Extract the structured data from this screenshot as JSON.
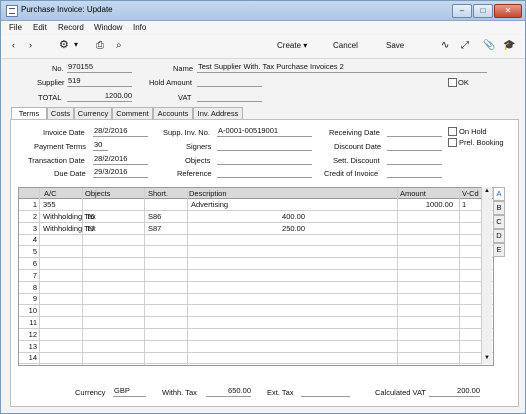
{
  "window": {
    "title": "Purchase Invoice: Update"
  },
  "menu": [
    "File",
    "Edit",
    "Record",
    "Window",
    "Info"
  ],
  "toolbar": {
    "create_label": "Create",
    "cancel_label": "Cancel",
    "save_label": "Save"
  },
  "header": {
    "no_label": "No.",
    "no_value": "970155",
    "name_label": "Name",
    "name_value": "Test Supplier With. Tax Purchase Invoices 2",
    "supplier_label": "Supplier",
    "supplier_value": "519",
    "hold_amount_label": "Hold Amount",
    "hold_amount_value": "",
    "ok_label": "OK",
    "total_label": "TOTAL",
    "total_value": "1200.00",
    "vat_label": "VAT",
    "vat_value": ""
  },
  "tabs": [
    "Terms",
    "Costs",
    "Currency",
    "Comment",
    "Accounts",
    "Inv. Address"
  ],
  "terms": {
    "invoice_date_label": "Invoice Date",
    "invoice_date": "28/2/2016",
    "supp_inv_no_label": "Supp. Inv. No.",
    "supp_inv_no": "A-0001-00519001",
    "receiving_date_label": "Receiving Date",
    "receiving_date": "",
    "on_hold_label": "On Hold",
    "payment_terms_label": "Payment Terms",
    "payment_terms": "30",
    "signers_label": "Signers",
    "signers": "",
    "discount_date_label": "Discount Date",
    "discount_date": "",
    "prel_booking_label": "Prel. Booking",
    "transaction_date_label": "Transaction Date",
    "transaction_date": "28/2/2016",
    "objects_label": "Objects",
    "objects": "",
    "sett_discount_label": "Sett. Discount",
    "sett_discount": "",
    "due_date_label": "Due Date",
    "due_date": "29/3/2016",
    "reference_label": "Reference",
    "reference": "",
    "credit_of_invoice_label": "Credit of Invoice",
    "credit_of_invoice": ""
  },
  "grid": {
    "columns": [
      "A/C",
      "Objects",
      "Short.",
      "Description",
      "Amount",
      "V-Cd"
    ],
    "rows": [
      {
        "n": "1",
        "ac": "355",
        "objects": "",
        "short": "",
        "description": "Advertising",
        "amount": "1000.00",
        "vcd": "1"
      },
      {
        "n": "2",
        "ac": "Withholding Tax",
        "objects": "T6",
        "short": "S86",
        "description": "400.00",
        "amount": "",
        "vcd": ""
      },
      {
        "n": "3",
        "ac": "Withholding Tax",
        "objects": "T7",
        "short": "S87",
        "description": "250.00",
        "amount": "",
        "vcd": ""
      },
      {
        "n": "4"
      },
      {
        "n": "5"
      },
      {
        "n": "6"
      },
      {
        "n": "7"
      },
      {
        "n": "8"
      },
      {
        "n": "9"
      },
      {
        "n": "10"
      },
      {
        "n": "11"
      },
      {
        "n": "12"
      },
      {
        "n": "13"
      },
      {
        "n": "14"
      }
    ],
    "side_tabs": [
      "A",
      "B",
      "C",
      "D",
      "E"
    ]
  },
  "footer": {
    "currency_label": "Currency",
    "currency": "GBP",
    "withh_tax_label": "Withh. Tax",
    "withh_tax": "650.00",
    "ext_tax_label": "Ext. Tax",
    "ext_tax": "",
    "calculated_vat_label": "Calculated VAT",
    "calculated_vat": "200.00"
  }
}
